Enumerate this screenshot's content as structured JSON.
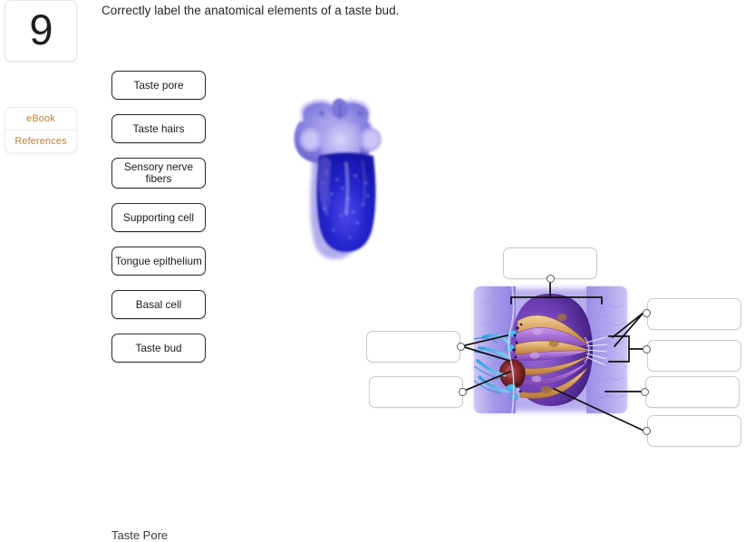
{
  "question": {
    "number": "9",
    "prompt": "Correctly label the anatomical elements of a taste bud."
  },
  "resources": {
    "ebook_label": "eBook",
    "references_label": "References",
    "link_color": "#b5843c"
  },
  "label_bank": {
    "items": [
      {
        "id": "taste-pore",
        "label": "Taste pore"
      },
      {
        "id": "taste-hairs",
        "label": "Taste hairs"
      },
      {
        "id": "sensory-nerve-fibers",
        "label": "Sensory nerve fibers"
      },
      {
        "id": "supporting-cell",
        "label": "Supporting cell"
      },
      {
        "id": "tongue-epithelium",
        "label": "Tongue epithelium"
      },
      {
        "id": "basal-cell",
        "label": "Basal cell"
      },
      {
        "id": "taste-bud",
        "label": "Taste bud"
      }
    ]
  },
  "drop_zones": [
    {
      "id": "dz-top",
      "value": "",
      "placeholder": ""
    },
    {
      "id": "dz-left-upper",
      "value": "",
      "placeholder": ""
    },
    {
      "id": "dz-left-lower",
      "value": "",
      "placeholder": ""
    },
    {
      "id": "dz-right-1",
      "value": "",
      "placeholder": ""
    },
    {
      "id": "dz-right-2",
      "value": "",
      "placeholder": ""
    },
    {
      "id": "dz-right-3",
      "value": "",
      "placeholder": ""
    },
    {
      "id": "dz-right-4",
      "value": "",
      "placeholder": ""
    }
  ],
  "figures": {
    "tongue": {
      "name": "tongue-dorsal-surface-photo"
    },
    "taste_bud": {
      "name": "taste-bud-cross-section-illustration"
    }
  },
  "clipped_bottom_text": "Taste Pore",
  "colors": {
    "label_border": "#2b2b2b",
    "dropzone_border": "#c9c9c9",
    "page_background": "#ffffff",
    "tongue_blue": "#2b2bd0",
    "tastebud_purple": "#8e44c4",
    "tastebud_tan": "#d9a05b",
    "nerve_blue": "#3aa8e8",
    "pore_red": "#8c2a2a"
  }
}
